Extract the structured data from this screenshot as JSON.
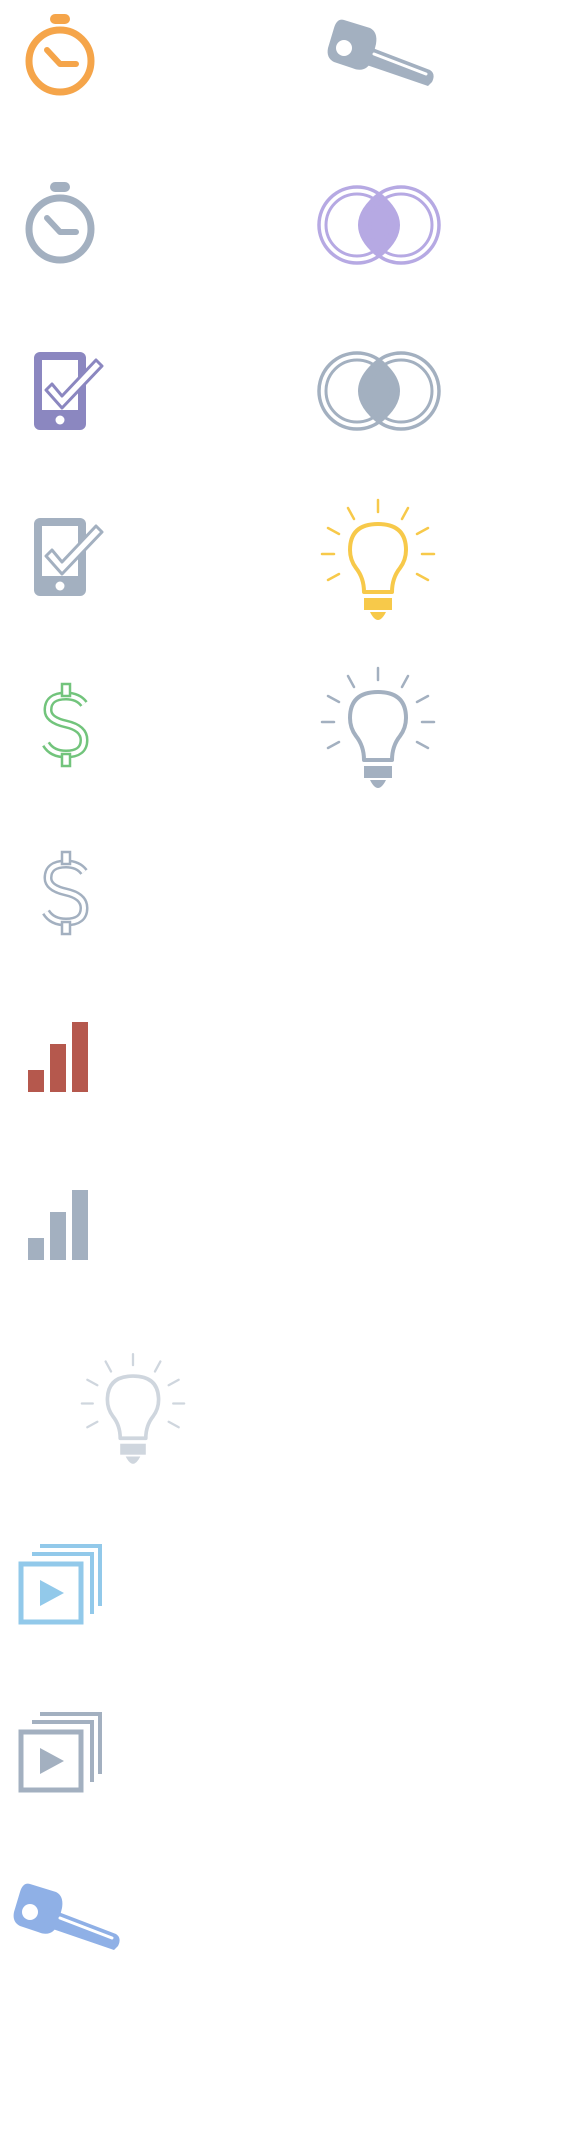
{
  "sprite_sheet": {
    "icons": [
      {
        "name": "stopwatch-icon",
        "color": "#f5a54a"
      },
      {
        "name": "key-icon",
        "color": "#a3b0c0"
      },
      {
        "name": "stopwatch-icon",
        "color": "#a3b0c0"
      },
      {
        "name": "rings-icon",
        "color": "#b6a9e3"
      },
      {
        "name": "tablet-check-icon",
        "color": "#8b87c0"
      },
      {
        "name": "rings-icon",
        "color": "#a3b0c0"
      },
      {
        "name": "tablet-check-icon",
        "color": "#a3b0c0"
      },
      {
        "name": "lightbulb-icon",
        "color": "#f7c94a"
      },
      {
        "name": "dollar-icon",
        "color": "#72c47c"
      },
      {
        "name": "lightbulb-icon",
        "color": "#a3b0c0"
      },
      {
        "name": "dollar-icon",
        "color": "#a3b0c0"
      },
      {
        "name": "bar-chart-icon",
        "color": "#b5584d"
      },
      {
        "name": "bar-chart-icon",
        "color": "#a3b0c0"
      },
      {
        "name": "lightbulb-icon",
        "color": "#cfd6de"
      },
      {
        "name": "media-stack-icon",
        "color": "#92c9ea"
      },
      {
        "name": "media-stack-icon",
        "color": "#a3b0c0"
      },
      {
        "name": "key-icon",
        "color": "#8fb0e6"
      }
    ]
  }
}
